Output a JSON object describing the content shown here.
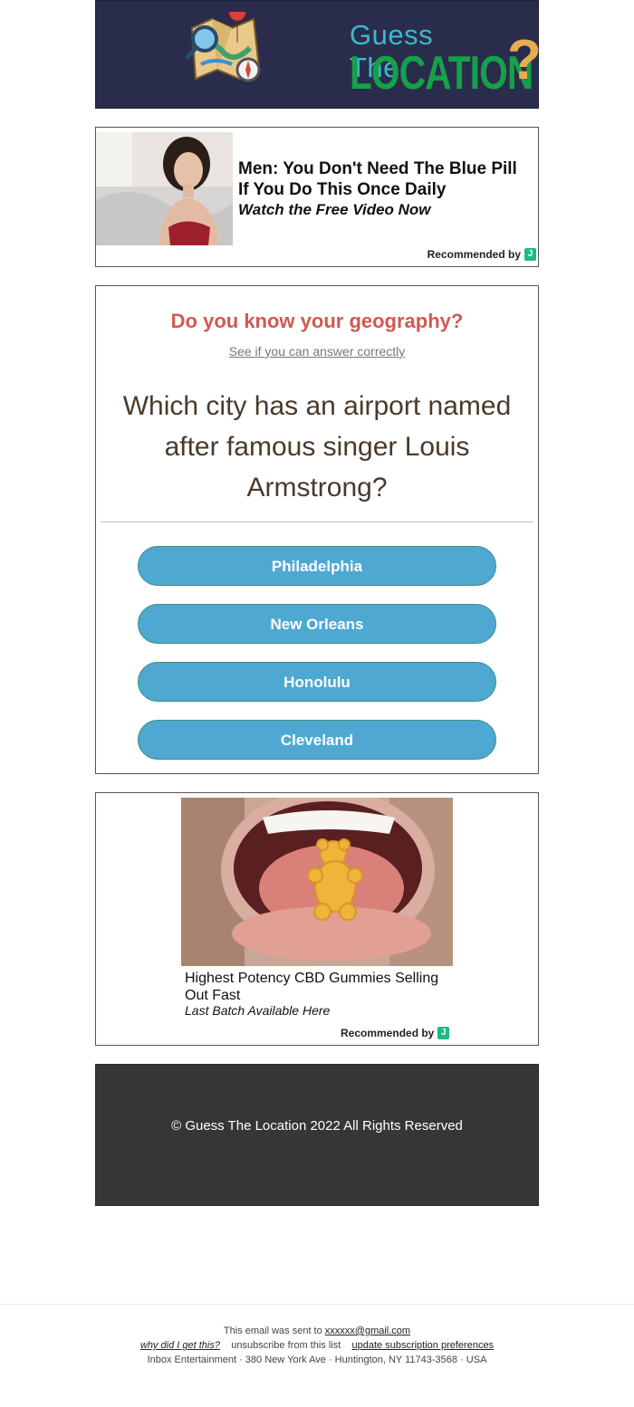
{
  "header": {
    "logo_line1": "Guess The",
    "logo_line2": "LOCATION",
    "logo_mark": "?",
    "colors": {
      "background": "#292d4b",
      "guess": "#3cb8cf",
      "location": "#16a04a",
      "question_mark": "#e8ac4f"
    }
  },
  "ad1": {
    "headline": "Men: You Don't Need The Blue Pill If You Do This Once Daily",
    "subline": "Watch the Free Video Now",
    "recommended": "Recommended by",
    "badge": "J"
  },
  "quiz": {
    "title": "Do you know your geography?",
    "subtitle": "See if you can answer correctly",
    "question": "Which city has an airport named after famous singer Louis Armstrong?",
    "answers": [
      "Philadelphia",
      "New Orleans",
      "Honolulu",
      "Cleveland"
    ],
    "colors": {
      "title": "#cf5a51",
      "button": "#4ea8d2",
      "question": "#4a3a2a"
    }
  },
  "ad2": {
    "headline": "Highest Potency CBD Gummies Selling Out Fast",
    "subline": "Last Batch Available Here",
    "recommended": "Recommended by",
    "badge": "J"
  },
  "footer": {
    "copyright": "© Guess The Location 2022 All Rights Reserved"
  },
  "email_footer": {
    "sent_to_prefix": "This email was sent to",
    "email": "xxxxxx@gmail.com",
    "why_link": "why did I get this?",
    "unsubscribe": "unsubscribe from this list",
    "preferences_link": "update subscription preferences",
    "address": "Inbox Entertainment · 380 New York Ave · Huntington, NY 11743-3568 · USA"
  }
}
